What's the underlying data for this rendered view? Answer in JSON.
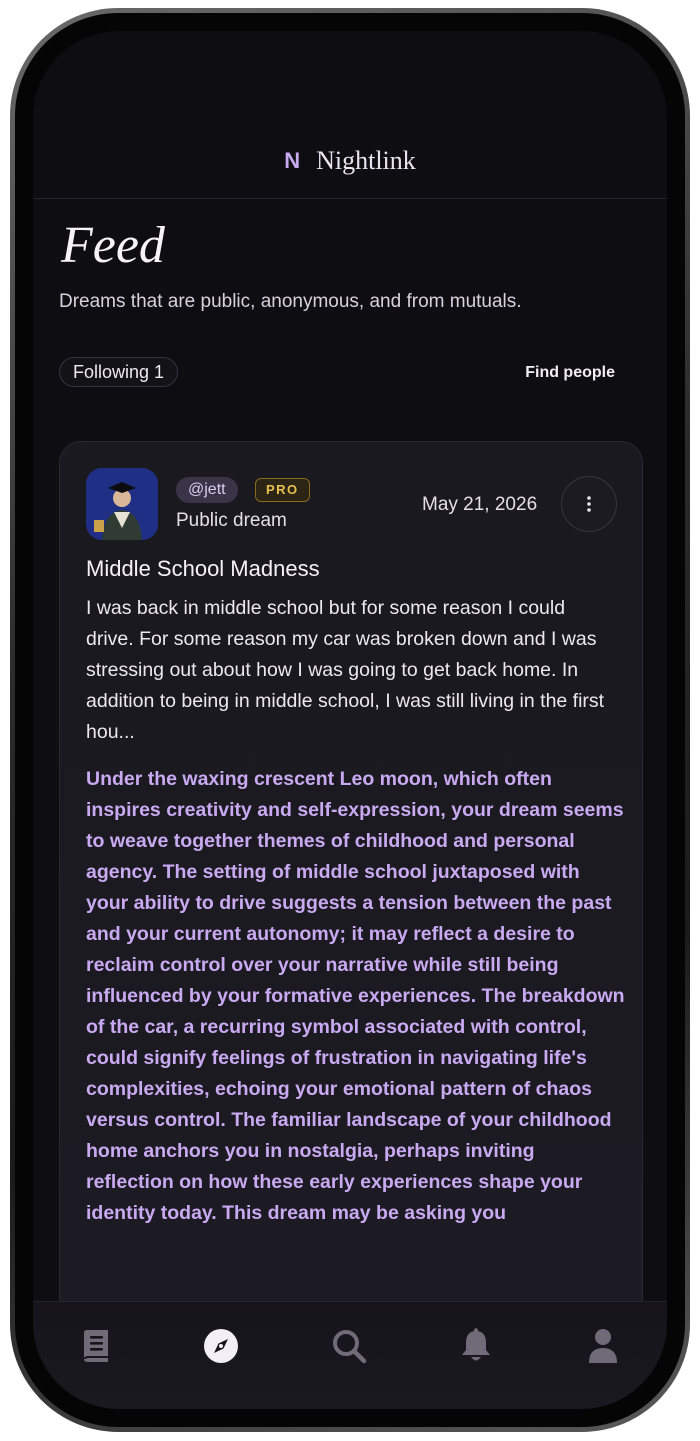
{
  "app": {
    "brand_mark": "N",
    "brand_name": "Nightlink"
  },
  "page": {
    "title": "Feed",
    "subtitle": "Dreams that are public, anonymous, and from mutuals."
  },
  "filters": {
    "following_label": "Following 1",
    "find_people_label": "Find people"
  },
  "card": {
    "handle": "@jett",
    "badge": "PRO",
    "visibility": "Public dream",
    "date": "May 21, 2026",
    "title": "Middle School Madness",
    "excerpt": "I was back in middle school but for some reason I could drive. For some reason my car was broken down and I was stressing out about how I was going to get back home. In addition to being in middle school, I was still living in the first hou...",
    "interpretation": "Under the waxing crescent Leo moon, which often inspires creativity and self-expression, your dream seems to weave together themes of childhood and personal agency. The setting of middle school juxtaposed with your ability to drive suggests a tension between the past and your current autonomy; it may reflect a desire to reclaim control over your narrative while still being influenced by your formative experiences. The breakdown of the car, a recurring symbol associated with control, could signify feelings of frustration in navigating life's complexities, echoing your emotional pattern of chaos versus control. The familiar landscape of your childhood home anchors you in nostalgia, perhaps inviting reflection on how these early experiences shape your identity today. This dream may be asking you"
  },
  "tabs": [
    {
      "icon": "journal-icon",
      "active": false
    },
    {
      "icon": "compass-icon",
      "active": true
    },
    {
      "icon": "search-icon",
      "active": false
    },
    {
      "icon": "bell-icon",
      "active": false
    },
    {
      "icon": "profile-icon",
      "active": false
    }
  ],
  "colors": {
    "background": "#0e0d12",
    "accent": "#c9a9f1",
    "pro_badge": "#e8c04f"
  }
}
